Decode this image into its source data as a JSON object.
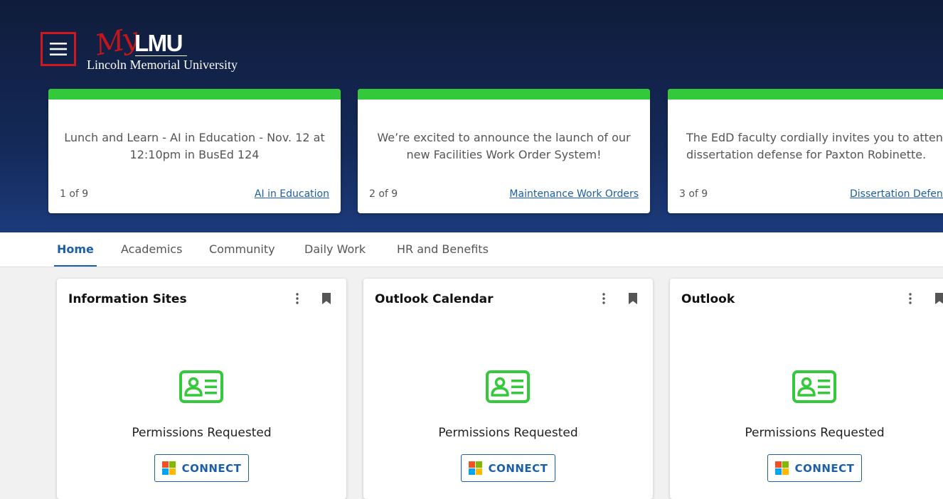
{
  "header": {
    "logo": {
      "my": "My",
      "brand": "LMU",
      "university": "Lincoln Memorial University"
    }
  },
  "announcements": [
    {
      "text": "Lunch and Learn - AI in Education - Nov. 12 at 12:10pm in BusEd 124",
      "counter": "1 of 9",
      "link": "AI in Education"
    },
    {
      "text": "We’re excited to announce the launch of our new Facilities Work Order System!",
      "counter": "2 of 9",
      "link": "Maintenance Work Orders"
    },
    {
      "text": "The EdD faculty cordially invites you to attend the dissertation defense for Paxton Robinette.",
      "counter": "3 of 9",
      "link": "Dissertation Defens"
    }
  ],
  "tabs": [
    {
      "label": "Home",
      "active": true
    },
    {
      "label": "Academics",
      "active": false
    },
    {
      "label": "Community",
      "active": false
    },
    {
      "label": "Daily Work",
      "active": false
    },
    {
      "label": "HR and Benefits",
      "active": false
    }
  ],
  "widgets": [
    {
      "title": "Information Sites",
      "status": "Permissions Requested",
      "button": "CONNECT"
    },
    {
      "title": "Outlook Calendar",
      "status": "Permissions Requested",
      "button": "CONNECT"
    },
    {
      "title": "Outlook",
      "status": "Permissions Requested",
      "button": "CONNECT"
    }
  ],
  "colors": {
    "accent_green": "#34c93a",
    "link_blue": "#1b5fa8",
    "menu_border_red": "#d1181e",
    "ms_red": "#f25022",
    "ms_green": "#7fba00",
    "ms_blue": "#00a4ef",
    "ms_yellow": "#ffb900"
  },
  "icons": {
    "menu": "hamburger-menu-icon",
    "kebab": "more-vertical-icon",
    "bookmark": "bookmark-icon",
    "permission": "id-card-icon",
    "connect": "microsoft-logo-icon"
  }
}
